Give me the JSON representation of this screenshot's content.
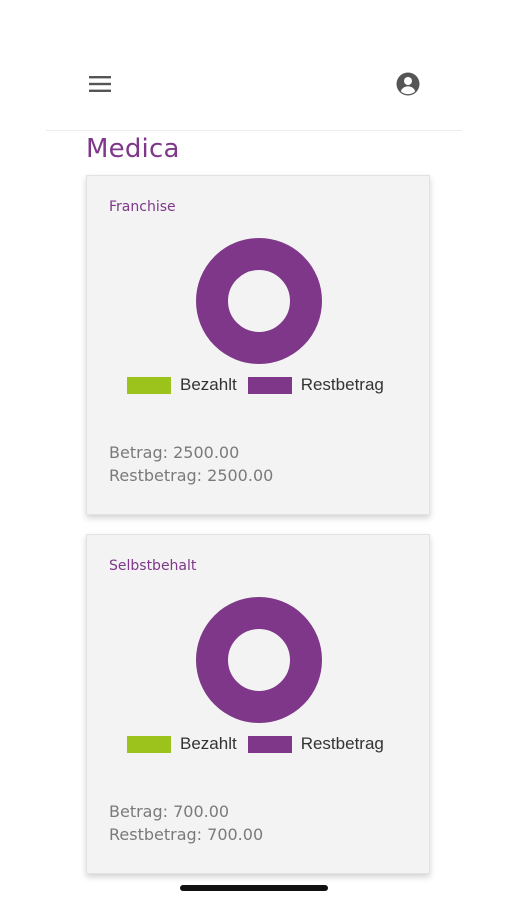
{
  "app": {
    "title": "Medica"
  },
  "header": {
    "menu_icon": "hamburger-menu-icon",
    "account_icon": "account-circle-icon"
  },
  "colors": {
    "accent": "#7e3789",
    "paid": "#9cc21c",
    "remaining": "#7e3789"
  },
  "cards": [
    {
      "title": "Franchise",
      "legend": {
        "paid_label": "Bezahlt",
        "remaining_label": "Restbetrag"
      },
      "amount_line": "Betrag: 2500.00",
      "remaining_line": "Restbetrag: 2500.00"
    },
    {
      "title": "Selbstbehalt",
      "legend": {
        "paid_label": "Bezahlt",
        "remaining_label": "Restbetrag"
      },
      "amount_line": "Betrag: 700.00",
      "remaining_line": "Restbetrag: 700.00"
    }
  ],
  "chart_data": [
    {
      "type": "pie",
      "categories": [
        "Bezahlt",
        "Restbetrag"
      ],
      "values": [
        0,
        2500
      ],
      "colors": [
        "#9cc21c",
        "#7e3789"
      ],
      "title": "Franchise",
      "legend_position": "bottom"
    },
    {
      "type": "pie",
      "categories": [
        "Bezahlt",
        "Restbetrag"
      ],
      "values": [
        0,
        700
      ],
      "colors": [
        "#9cc21c",
        "#7e3789"
      ],
      "title": "Selbstbehalt",
      "legend_position": "bottom"
    }
  ]
}
